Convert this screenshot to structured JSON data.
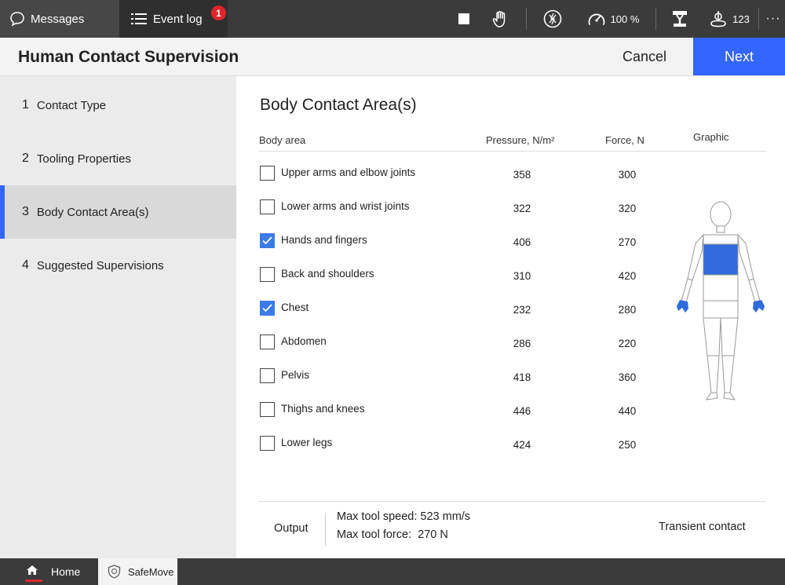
{
  "topbar": {
    "messages_label": "Messages",
    "eventlog_label": "Event log",
    "eventlog_badge": "1",
    "speed_value": "100 %",
    "jog_value": "123",
    "more_label": "···",
    "icons": [
      "chat-icon",
      "list-icon",
      "stop-icon",
      "hand-icon",
      "motor-off-icon",
      "speed-gauge-icon",
      "robot-icon",
      "jog-icon"
    ]
  },
  "header": {
    "title": "Human Contact Supervision",
    "cancel_label": "Cancel",
    "next_label": "Next"
  },
  "sidebar": {
    "steps": [
      {
        "num": "1",
        "label": "Contact Type",
        "active": false
      },
      {
        "num": "2",
        "label": "Tooling Properties",
        "active": false
      },
      {
        "num": "3",
        "label": "Body Contact Area(s)",
        "active": true
      },
      {
        "num": "4",
        "label": "Suggested Supervisions",
        "active": false
      }
    ]
  },
  "main": {
    "title": "Body Contact Area(s)",
    "columns": {
      "body_area": "Body area",
      "pressure": "Pressure, N/m²",
      "force": "Force, N",
      "graphic": "Graphic"
    },
    "rows": [
      {
        "label": "Upper arms and elbow joints",
        "pressure": "358",
        "force": "300",
        "checked": false
      },
      {
        "label": "Lower arms and wrist joints",
        "pressure": "322",
        "force": "320",
        "checked": false
      },
      {
        "label": "Hands and fingers",
        "pressure": "406",
        "force": "270",
        "checked": true
      },
      {
        "label": "Back and shoulders",
        "pressure": "310",
        "force": "420",
        "checked": false
      },
      {
        "label": "Chest",
        "pressure": "232",
        "force": "280",
        "checked": true
      },
      {
        "label": "Abdomen",
        "pressure": "286",
        "force": "220",
        "checked": false
      },
      {
        "label": "Pelvis",
        "pressure": "418",
        "force": "360",
        "checked": false
      },
      {
        "label": "Thighs and knees",
        "pressure": "446",
        "force": "440",
        "checked": false
      },
      {
        "label": "Lower legs",
        "pressure": "424",
        "force": "250",
        "checked": false
      }
    ],
    "output": {
      "label": "Output",
      "speed_line": "Max tool speed: 523 mm/s",
      "force_line": "Max tool force:  270 N",
      "contact_type": "Transient contact"
    }
  },
  "taskbar": {
    "home_label": "Home",
    "safemove_label": "SafeMove"
  },
  "colors": {
    "accent": "#3366ff",
    "checkbox_checked": "#3a7be8",
    "highlight_body": "#2f6bdc",
    "badge": "#e0262a",
    "topbar_bg": "#3b3b3b"
  }
}
